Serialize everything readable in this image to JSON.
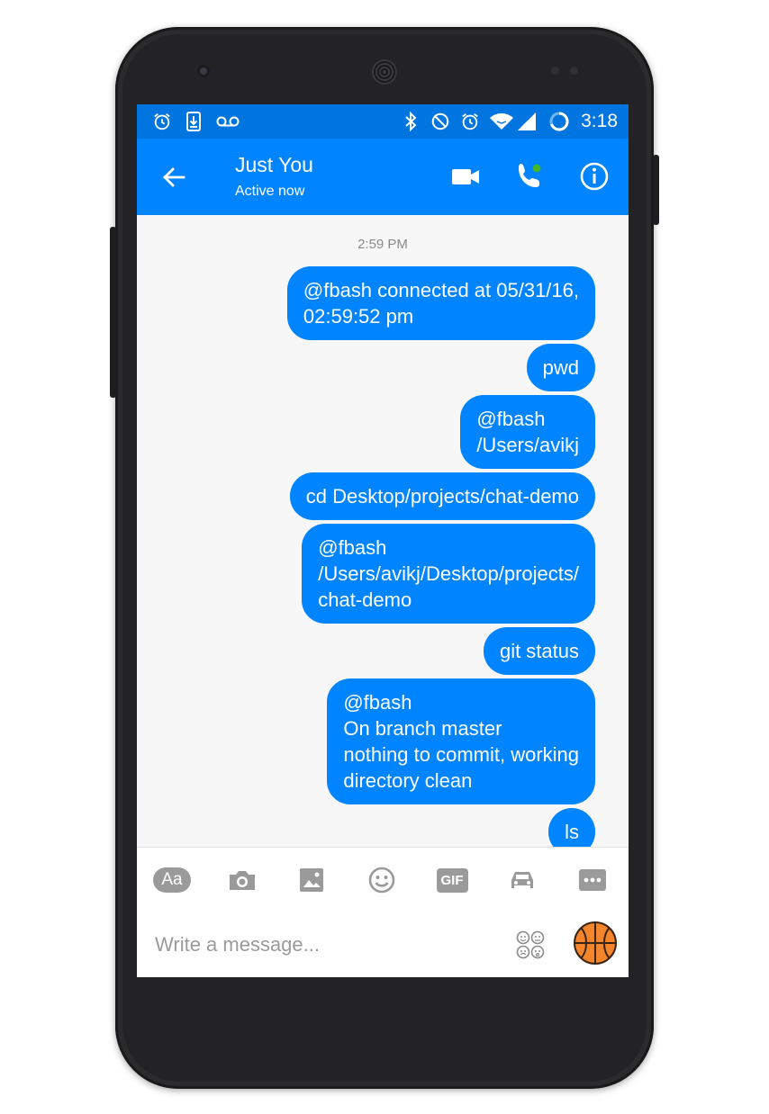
{
  "status_bar": {
    "time": "3:18",
    "left_icons": [
      "alarm-icon",
      "download-icon",
      "voicemail-icon"
    ],
    "right_icons": [
      "bluetooth-icon",
      "do-not-disturb-icon",
      "alarm-icon",
      "wifi-icon",
      "signal-icon",
      "battery-icon"
    ]
  },
  "header": {
    "title": "Just You",
    "subtitle": "Active now",
    "icons": [
      "back-arrow-icon",
      "video-call-icon",
      "phone-call-icon",
      "info-icon"
    ],
    "bar_color": "#0084ff",
    "status_color": "#0075e0",
    "online_dot_color": "#42b72a"
  },
  "conversation": {
    "timestamp": "2:59 PM",
    "bubble_color": "#0084ff",
    "messages": [
      "@fbash connected at 05/31/16,\n02:59:52 pm",
      "pwd",
      "@fbash\n/Users/avikj",
      "cd Desktop/projects/chat-demo",
      "@fbash\n/Users/avikj/Desktop/projects/\nchat-demo",
      "git status",
      "@fbash\nOn branch master\nnothing to commit, working\ndirectory clean",
      "ls"
    ]
  },
  "toolbar": {
    "aa_label": "Aa",
    "gif_label": "GIF",
    "icons": [
      "text-style-icon",
      "camera-icon",
      "image-icon",
      "emoji-icon",
      "gif-icon",
      "car-icon",
      "more-icon"
    ]
  },
  "composer": {
    "placeholder": "Write a message...",
    "value": "",
    "icons": [
      "stickers-icon",
      "basketball-icon"
    ]
  }
}
